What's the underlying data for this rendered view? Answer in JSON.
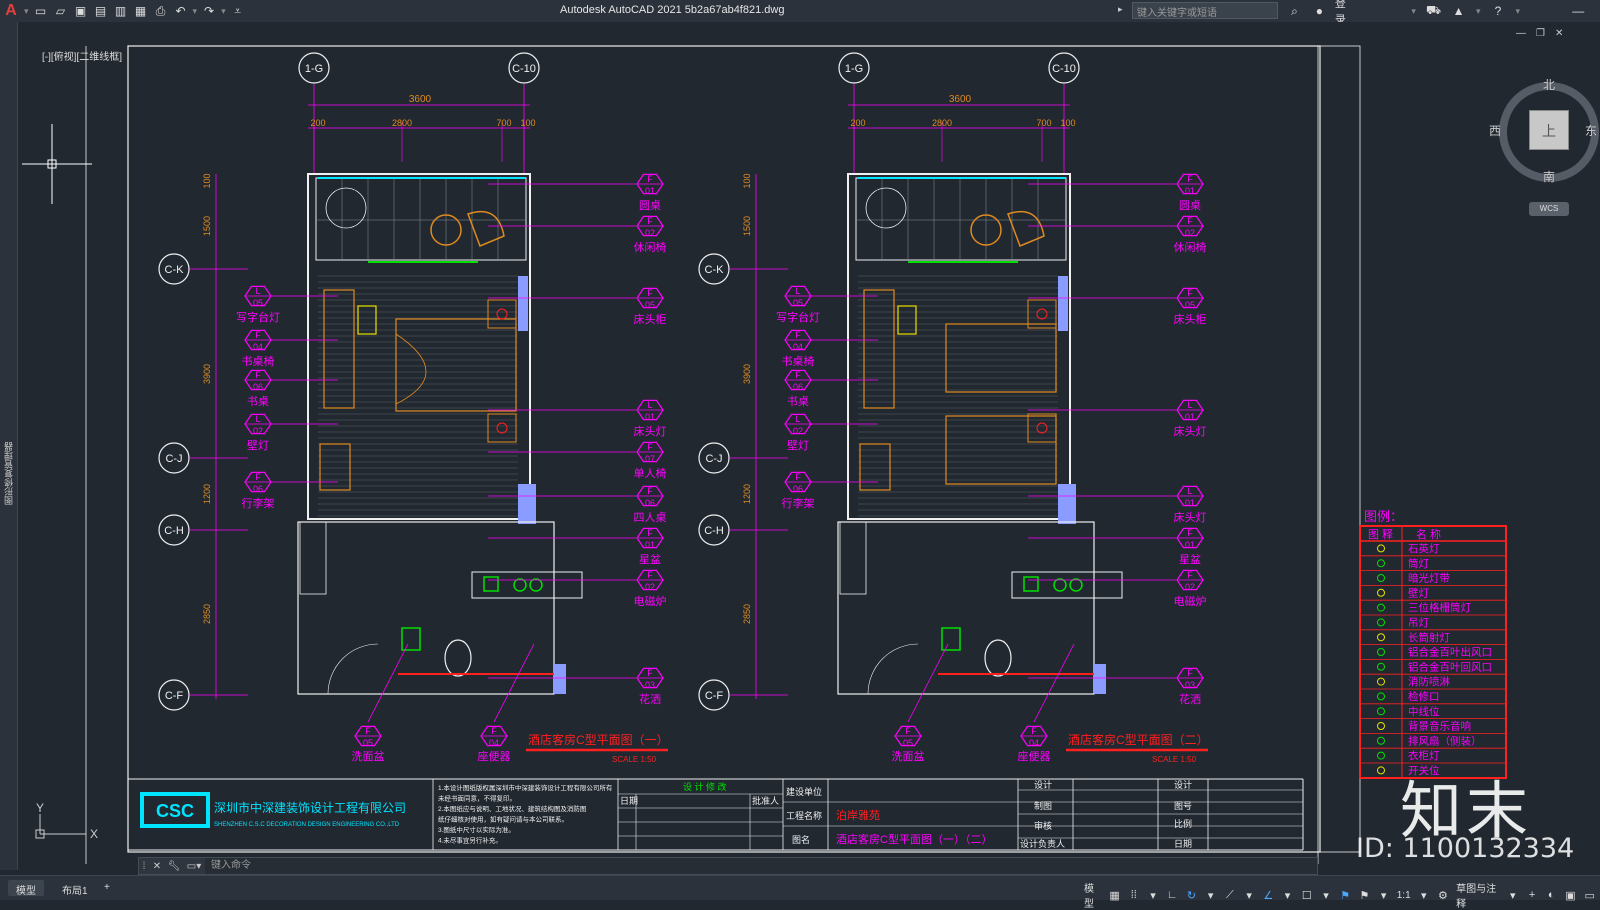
{
  "titlebar": {
    "app_logo": "A",
    "title": "Autodesk AutoCAD 2021    5b2a67ab4f821.dwg",
    "search_placeholder": "键入关键字或短语",
    "login_label": "登录"
  },
  "viewport": {
    "label": "[-][俯视][二维线框]",
    "left_strip_label": "图形修复管理器"
  },
  "viewcube": {
    "north": "北",
    "south": "南",
    "east": "东",
    "west": "西",
    "top": "上",
    "wcs": "WCS"
  },
  "plans": [
    {
      "axis_top": [
        "1-G",
        "C-10"
      ],
      "dim_total": "3600",
      "dims": [
        "200",
        "2800",
        "700",
        "100"
      ],
      "axis_left": [
        "C-K",
        "C-J",
        "C-H",
        "C-F"
      ],
      "vert_dims": [
        "100",
        "1500",
        "3900",
        "1200",
        "2850"
      ],
      "tags": [
        {
          "code": "F",
          "num": "01",
          "name": "圆桌"
        },
        {
          "code": "F",
          "num": "02",
          "name": "休闲椅"
        },
        {
          "code": "F",
          "num": "05",
          "name": "床头柜"
        },
        {
          "code": "L",
          "num": "01",
          "name": "床头灯"
        },
        {
          "code": "F",
          "num": "07",
          "name": "单人椅"
        },
        {
          "code": "F",
          "num": "06",
          "name": "四人桌"
        },
        {
          "code": "F",
          "num": "01",
          "name": "星盆"
        },
        {
          "code": "F",
          "num": "02",
          "name": "电磁炉"
        },
        {
          "code": "F",
          "num": "03",
          "name": "花洒"
        }
      ],
      "left_tags": [
        {
          "code": "L",
          "num": "05",
          "name": "写字台灯"
        },
        {
          "code": "F",
          "num": "04",
          "name": "书桌椅"
        },
        {
          "code": "F",
          "num": "06",
          "name": "书桌"
        },
        {
          "code": "L",
          "num": "02",
          "name": "壁灯"
        },
        {
          "code": "F",
          "num": "06",
          "name": "行李架"
        }
      ],
      "bottom_tags": [
        {
          "code": "F",
          "num": "05",
          "name": "洗面盆"
        },
        {
          "code": "F",
          "num": "04",
          "name": "座便器"
        }
      ],
      "title": "酒店客房C型平面图（一）",
      "scale": "SCALE 1:50"
    },
    {
      "axis_top": [
        "1-G",
        "C-10"
      ],
      "dim_total": "3600",
      "dims": [
        "200",
        "2800",
        "700",
        "100"
      ],
      "axis_left": [
        "C-K",
        "C-J",
        "C-H",
        "C-F"
      ],
      "vert_dims": [
        "100",
        "1500",
        "3900",
        "1200",
        "2850"
      ],
      "tags": [
        {
          "code": "F",
          "num": "01",
          "name": "圆桌"
        },
        {
          "code": "F",
          "num": "02",
          "name": "休闲椅"
        },
        {
          "code": "F",
          "num": "05",
          "name": "床头柜"
        },
        {
          "code": "L",
          "num": "01",
          "name": "床头灯"
        },
        {
          "code": "L",
          "num": "01",
          "name": "床头灯"
        },
        {
          "code": "F",
          "num": "01",
          "name": "星盆"
        },
        {
          "code": "F",
          "num": "02",
          "name": "电磁炉"
        },
        {
          "code": "F",
          "num": "03",
          "name": "花洒"
        }
      ],
      "left_tags": [
        {
          "code": "L",
          "num": "05",
          "name": "写字台灯"
        },
        {
          "code": "F",
          "num": "04",
          "name": "书桌椅"
        },
        {
          "code": "F",
          "num": "06",
          "name": "书桌"
        },
        {
          "code": "L",
          "num": "02",
          "name": "壁灯"
        },
        {
          "code": "F",
          "num": "06",
          "name": "行李架"
        }
      ],
      "bottom_tags": [
        {
          "code": "F",
          "num": "05",
          "name": "洗面盆"
        },
        {
          "code": "F",
          "num": "04",
          "name": "座便器"
        }
      ],
      "title": "酒店客房C型平面图（二）",
      "scale": "SCALE 1:50"
    }
  ],
  "legend": {
    "title": "图例：",
    "header": [
      "图 释",
      "名    称"
    ],
    "items": [
      "石英灯",
      "筒灯",
      "暗光灯带",
      "壁灯",
      "三位格栅筒灯",
      "吊灯",
      "长筒射灯",
      "铝合金百叶出风口",
      "铝合金百叶回风口",
      "消防喷淋",
      "检修口",
      "中线位",
      "背景音乐音响",
      "排风扇（侧装）",
      "衣柜灯",
      "开关位"
    ]
  },
  "titleblock": {
    "company_cn": "深圳市中深建装饰设计工程有限公司",
    "company_en": "SHENZHEN C.S.C DECORATION DESIGN ENGINEERING CO.,LTD",
    "logo": "CSC",
    "notes": [
      "1.本设计图纸版权属深圳市中深建装饰设计工程有限公司所有",
      "未经书面同意，不得复印。",
      "2.本图纸应与说明、工地状况、建筑结构图及消防图",
      "纸仔细核对使用，如有疑问请与本公司联系。",
      "3.图纸中尺寸以实际为准。",
      "4.未尽事宜另行补充。"
    ],
    "revision_header": "设 计 修 改",
    "date_label": "日期",
    "approver_label": "批准人",
    "client_label": "建设单位",
    "project_label": "工程名称",
    "project_name": "泊岸雅苑",
    "drawing_label": "图名",
    "drawing_name": "酒店客房C型平面图（一）（二）",
    "design_label": "设计",
    "draw_label": "制图",
    "check_label": "审核",
    "lead_label": "设计负责人",
    "design2_label": "设计",
    "drawing_no_label": "图号",
    "ratio_label": "比例",
    "date2_label": "日期"
  },
  "command": {
    "placeholder": "键入命令"
  },
  "statusbar": {
    "tab_model": "模型",
    "tab_layout1": "布局1",
    "tab_add": "+",
    "model_label": "模型",
    "scale": "1:1",
    "workspace": "草图与注释"
  },
  "watermark": {
    "id": "ID: 1100132334",
    "logo": "知末"
  },
  "colors": {
    "magenta": "#ff00ff",
    "orange": "#e08a20",
    "cyan": "#00e5ff",
    "white": "#f0f0f0",
    "red": "#ff2020",
    "green": "#00e000",
    "background": "#212830"
  }
}
